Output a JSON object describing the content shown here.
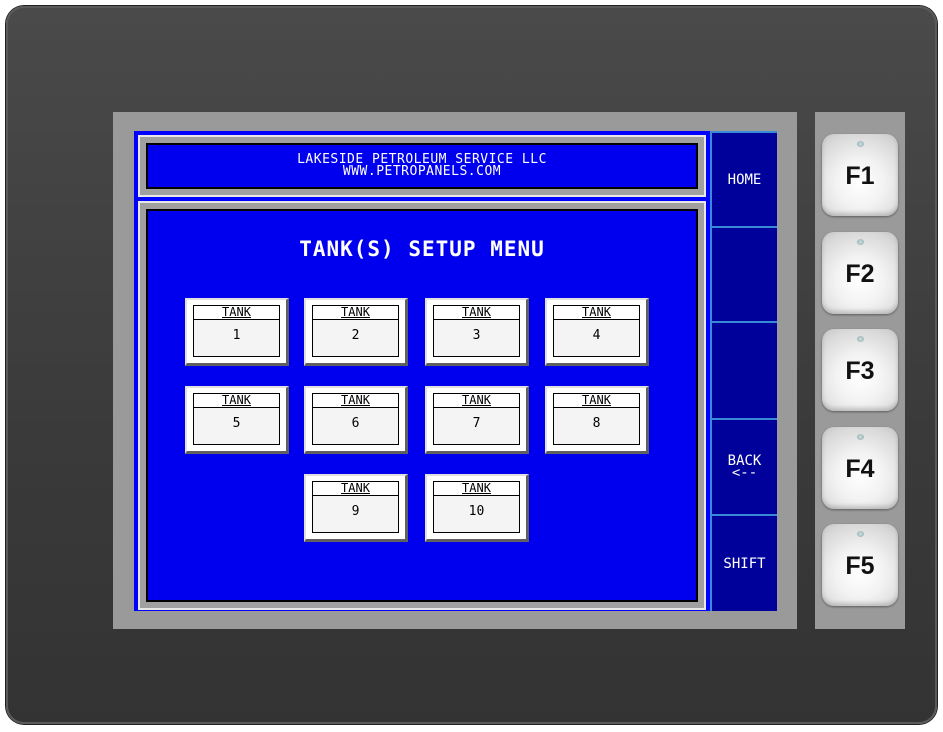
{
  "header": {
    "line1": "LAKESIDE PETROLEUM SERVICE LLC",
    "line2": "WWW.PETROPANELS.COM"
  },
  "menu": {
    "title": "TANK(S) SETUP MENU"
  },
  "tanks": [
    {
      "label": "TANK",
      "number": "1"
    },
    {
      "label": "TANK",
      "number": "2"
    },
    {
      "label": "TANK",
      "number": "3"
    },
    {
      "label": "TANK",
      "number": "4"
    },
    {
      "label": "TANK",
      "number": "5"
    },
    {
      "label": "TANK",
      "number": "6"
    },
    {
      "label": "TANK",
      "number": "7"
    },
    {
      "label": "TANK",
      "number": "8"
    },
    {
      "label": "TANK",
      "number": "9"
    },
    {
      "label": "TANK",
      "number": "10"
    }
  ],
  "softkeys": {
    "home": "HOME",
    "blank1": "",
    "blank2": "",
    "back_line1": "BACK",
    "back_line2": "<--",
    "shift": "SHIFT"
  },
  "fkeys": [
    "F1",
    "F2",
    "F3",
    "F4",
    "F5"
  ],
  "colors": {
    "screen_blue": "#0000ee",
    "softkey_navy": "#00009a",
    "bezel": "#3a3a3a",
    "frame_gray": "#9a9a9a"
  }
}
